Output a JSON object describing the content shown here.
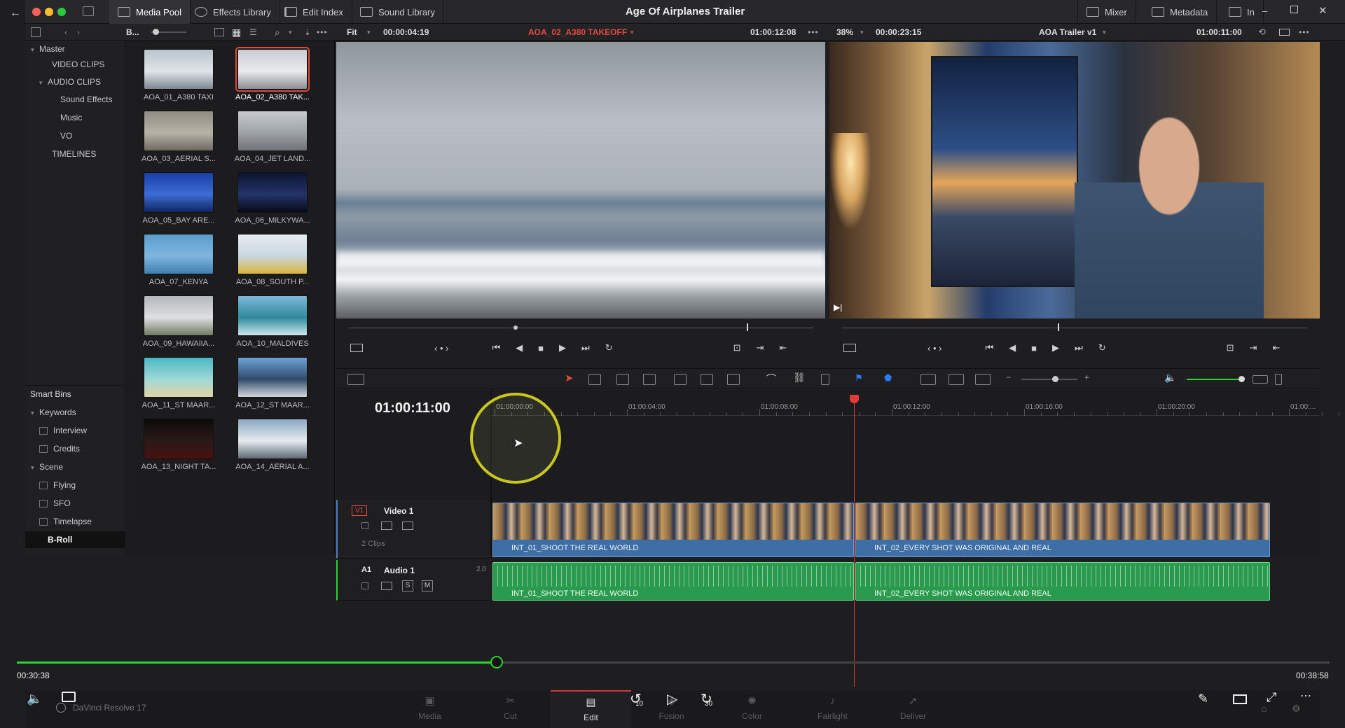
{
  "window": {
    "title": "Age Of Airplanes Trailer"
  },
  "titlebar": {
    "tabs": [
      {
        "label": "Media Pool",
        "icon": "media-pool-icon"
      },
      {
        "label": "Effects Library",
        "icon": "effects-icon"
      },
      {
        "label": "Edit Index",
        "icon": "list-icon"
      },
      {
        "label": "Sound Library",
        "icon": "sound-icon"
      }
    ],
    "right": [
      {
        "label": "Mixer"
      },
      {
        "label": "Metadata"
      },
      {
        "label": "In"
      }
    ]
  },
  "subbar": {
    "bin_label": "B...",
    "src_zoom": "Fit",
    "src_duration": "00:00:04:19",
    "src_clip": "AOA_02_A380 TAKEOFF",
    "src_timecode": "01:00:12:08",
    "rec_zoom": "38%",
    "rec_duration": "00:00:23:15",
    "timeline_name": "AOA Trailer v1",
    "rec_timecode": "01:00:11:00"
  },
  "bins": {
    "items": [
      {
        "label": "Master",
        "level": 0,
        "caret": "▾"
      },
      {
        "label": "VIDEO CLIPS",
        "level": 1,
        "caret": ""
      },
      {
        "label": "AUDIO CLIPS",
        "level": 1,
        "caret": "▾"
      },
      {
        "label": "Sound Effects",
        "level": 2,
        "caret": ""
      },
      {
        "label": "Music",
        "level": 2,
        "caret": ""
      },
      {
        "label": "VO",
        "level": 2,
        "caret": ""
      },
      {
        "label": "TIMELINES",
        "level": 1,
        "caret": ""
      }
    ],
    "smart_title": "Smart Bins",
    "smart": [
      {
        "label": "Keywords",
        "type": "group"
      },
      {
        "label": "Interview",
        "type": "item"
      },
      {
        "label": "Credits",
        "type": "item"
      },
      {
        "label": "Scene",
        "type": "group"
      },
      {
        "label": "Flying",
        "type": "item"
      },
      {
        "label": "SFO",
        "type": "item"
      },
      {
        "label": "Timelapse",
        "type": "item"
      },
      {
        "label": "B-Roll",
        "type": "selected"
      }
    ]
  },
  "clips": [
    {
      "label": "AOA_01_A380 TAXI",
      "colors": [
        "#b9c3cc",
        "#dfe4e8",
        "#7d8791"
      ]
    },
    {
      "label": "AOA_02_A380 TAK...",
      "colors": [
        "#c9cdd2",
        "#e9eaec",
        "#8a8e93"
      ],
      "selected": true
    },
    {
      "label": "AOA_03_AERIAL S...",
      "colors": [
        "#8f8c84",
        "#b7b2a6",
        "#6e6a62"
      ]
    },
    {
      "label": "AOA_04_JET LAND...",
      "colors": [
        "#c7cbd0",
        "#9ea3a8",
        "#6f7276"
      ]
    },
    {
      "label": "AOA_05_BAY ARE...",
      "colors": [
        "#1a3ea8",
        "#3c6dd6",
        "#11245f"
      ]
    },
    {
      "label": "AOA_06_MILKYWA...",
      "colors": [
        "#0d1330",
        "#243469",
        "#070a18"
      ]
    },
    {
      "label": "AOA_07_KENYA",
      "colors": [
        "#5a9ccf",
        "#7fb6de",
        "#3f7fb0"
      ]
    },
    {
      "label": "AOA_08_SOUTH P...",
      "colors": [
        "#e6eef2",
        "#c9d6de",
        "#d8b43a"
      ]
    },
    {
      "label": "AOA_09_HAWAIIA...",
      "colors": [
        "#b3b8bc",
        "#dedfe0",
        "#6f7a64"
      ]
    },
    {
      "label": "AOA_10_MALDIVES",
      "colors": [
        "#7fb7d6",
        "#2f8a9c",
        "#cfe6ee"
      ]
    },
    {
      "label": "AOA_11_ST MAAR...",
      "colors": [
        "#4bb6c4",
        "#9fd9d6",
        "#e3d3a4"
      ]
    },
    {
      "label": "AOA_12_ST MAAR...",
      "colors": [
        "#6da2d6",
        "#2f4a6a",
        "#d2d7db"
      ]
    },
    {
      "label": "AOA_13_NIGHT TA...",
      "colors": [
        "#0c0a0a",
        "#2a1a18",
        "#4a1010"
      ]
    },
    {
      "label": "AOA_14_AERIAL A...",
      "colors": [
        "#8aa7c4",
        "#e7ebee",
        "#5d6b78"
      ]
    }
  ],
  "timeline": {
    "timecode": "01:00:11:00",
    "ruler": [
      "01:00:00:00",
      "01:00:04:00",
      "01:00:08:00",
      "01:00:12:00",
      "01:00:16:00",
      "01:00:20:00",
      "01:00:..."
    ],
    "v1": {
      "tag": "V1",
      "name": "Video 1",
      "count": "2 Clips"
    },
    "a1": {
      "tag": "A1",
      "name": "Audio 1",
      "channels": "2.0",
      "solo": "S",
      "mute": "M"
    },
    "video_clips": [
      "INT_01_SHOOT THE REAL WORLD",
      "INT_02_EVERY SHOT WAS ORIGINAL AND REAL"
    ],
    "audio_clips": [
      "INT_01_SHOOT THE REAL WORLD",
      "INT_02_EVERY SHOT WAS ORIGINAL AND REAL"
    ]
  },
  "pages": [
    {
      "label": "Media",
      "icon": "media-page-icon"
    },
    {
      "label": "Cut",
      "icon": "cut-page-icon"
    },
    {
      "label": "Edit",
      "icon": "edit-page-icon",
      "active": true
    },
    {
      "label": "Fusion",
      "icon": "fusion-page-icon"
    },
    {
      "label": "Color",
      "icon": "color-page-icon"
    },
    {
      "label": "Fairlight",
      "icon": "fairlight-page-icon"
    },
    {
      "label": "Deliver",
      "icon": "deliver-page-icon"
    }
  ],
  "brand": "DaVinci Resolve 17",
  "player": {
    "elapsed": "00:30:38",
    "total": "00:38:58",
    "progress": 0.3656,
    "rewind": "10",
    "forward": "30"
  }
}
